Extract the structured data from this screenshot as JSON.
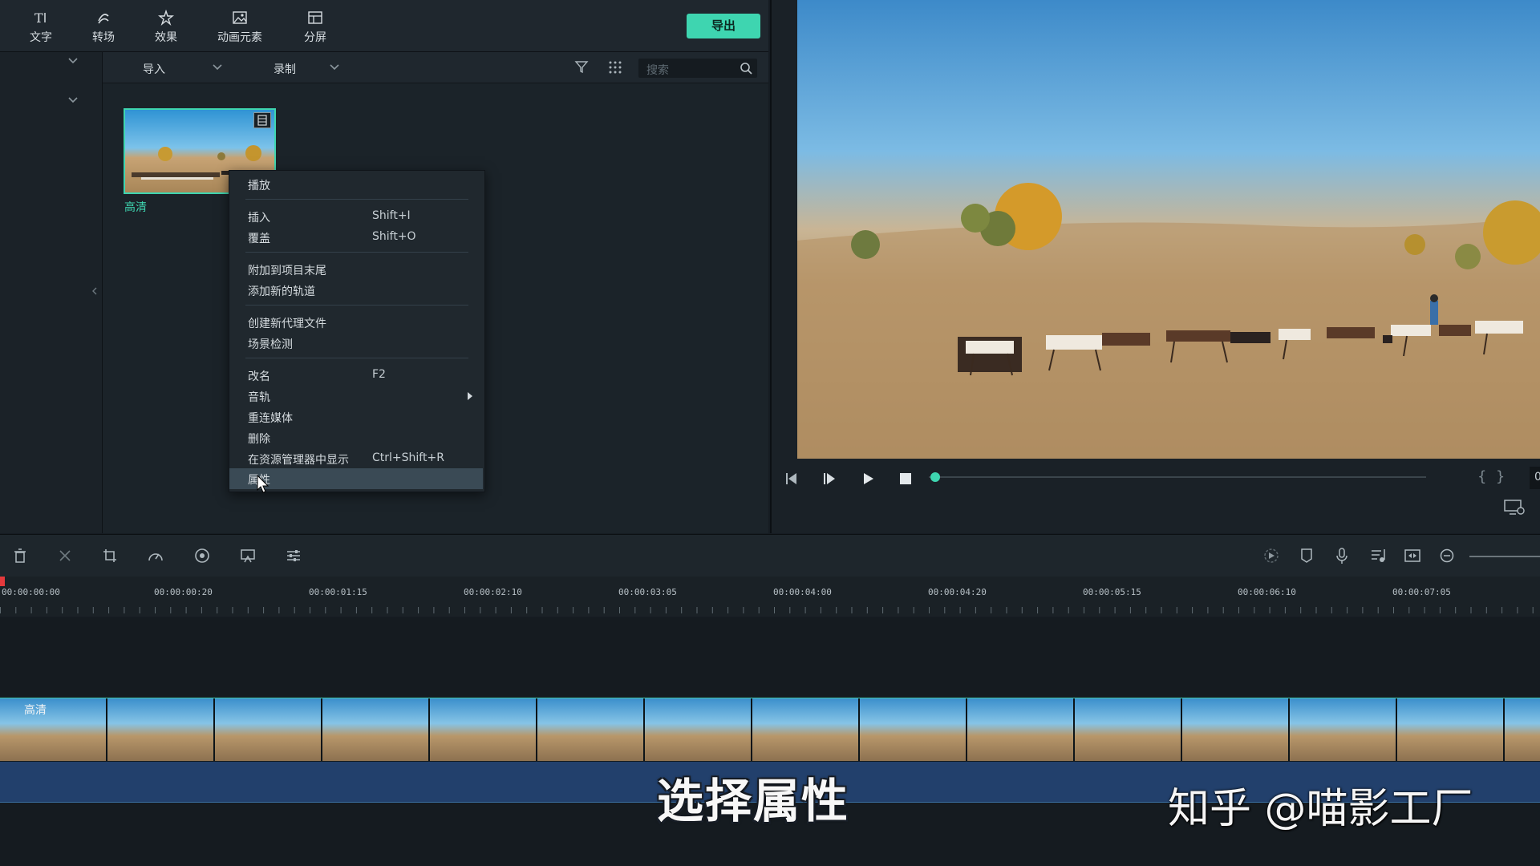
{
  "toolbar": {
    "items": [
      {
        "label": "文字",
        "icon": "text-icon"
      },
      {
        "label": "转场",
        "icon": "transition-icon"
      },
      {
        "label": "效果",
        "icon": "effects-icon"
      },
      {
        "label": "动画元素",
        "icon": "animation-elements-icon"
      },
      {
        "label": "分屏",
        "icon": "split-screen-icon"
      }
    ],
    "export_label": "导出"
  },
  "media_bar": {
    "import_label": "导入",
    "record_label": "录制",
    "search_placeholder": "搜索"
  },
  "media_item": {
    "label": "高清"
  },
  "context_menu": {
    "items": [
      {
        "label": "播放",
        "shortcut": ""
      },
      {
        "label": "插入",
        "shortcut": "Shift+I"
      },
      {
        "label": "覆盖",
        "shortcut": "Shift+O"
      },
      {
        "label": "附加到项目末尾",
        "shortcut": ""
      },
      {
        "label": "添加新的轨道",
        "shortcut": ""
      },
      {
        "label": "创建新代理文件",
        "shortcut": ""
      },
      {
        "label": "场景检测",
        "shortcut": ""
      },
      {
        "label": "改名",
        "shortcut": "F2"
      },
      {
        "label": "音轨",
        "shortcut": ""
      },
      {
        "label": "重连媒体",
        "shortcut": ""
      },
      {
        "label": "删除",
        "shortcut": ""
      },
      {
        "label": "在资源管理器中显示",
        "shortcut": "Ctrl+Shift+R"
      },
      {
        "label": "属性",
        "shortcut": ""
      }
    ],
    "highlighted": "属性"
  },
  "preview": {
    "timecode_fragment": "0"
  },
  "timeline": {
    "ticks": [
      "00:00:00:00",
      "00:00:00:20",
      "00:00:01:15",
      "00:00:02:10",
      "00:00:03:05",
      "00:00:04:00",
      "00:00:04:20",
      "00:00:05:15",
      "00:00:06:10",
      "00:00:07:05"
    ],
    "clip_label": "高清"
  },
  "overlay": {
    "caption": "选择属性",
    "watermark": "知乎 @喵影工厂"
  },
  "colors": {
    "accent": "#3ed5b0",
    "panel": "#1b2329",
    "audio_track": "#22406c"
  }
}
